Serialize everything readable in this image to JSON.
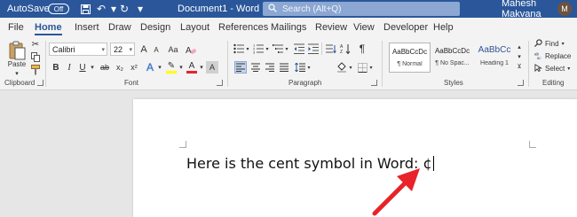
{
  "titlebar": {
    "autosave_label": "AutoSave",
    "autosave_state": "Off",
    "doc_title": "Document1 - Word",
    "search_placeholder": "Search (Alt+Q)",
    "user_name": "Mahesh Makvana",
    "avatar_initial": "M"
  },
  "tabs": [
    "File",
    "Home",
    "Insert",
    "Draw",
    "Design",
    "Layout",
    "References",
    "Mailings",
    "Review",
    "View",
    "Developer",
    "Help"
  ],
  "active_tab": "Home",
  "ribbon": {
    "clipboard": {
      "paste_label": "Paste",
      "group_label": "Clipboard"
    },
    "font": {
      "font_name": "Calibri",
      "font_size": "22",
      "grow": "A",
      "shrink": "A",
      "case": "Aa",
      "bold": "B",
      "italic": "I",
      "underline": "U",
      "strike": "ab",
      "subscript": "x₂",
      "superscript": "x²",
      "effects": "A",
      "highlight": "✎",
      "color": "A",
      "shade": "A",
      "group_label": "Font"
    },
    "paragraph": {
      "group_label": "Paragraph",
      "pilcrow": "¶"
    },
    "styles": {
      "items": [
        {
          "sample": "AaBbCcDc",
          "name": "¶ Normal"
        },
        {
          "sample": "AaBbCcDc",
          "name": "¶ No Spac..."
        },
        {
          "sample": "AaBbCc",
          "name": "Heading 1"
        }
      ],
      "group_label": "Styles"
    },
    "editing": {
      "find": "Find",
      "replace": "Replace",
      "select": "Select",
      "group_label": "Editing"
    }
  },
  "document": {
    "text": "Here is the cent symbol in Word: ¢"
  },
  "colors": {
    "titlebar": "#2b579a",
    "arrow": "#e8232a",
    "highlight": "#ffff00",
    "font_color": "#e8232a"
  }
}
